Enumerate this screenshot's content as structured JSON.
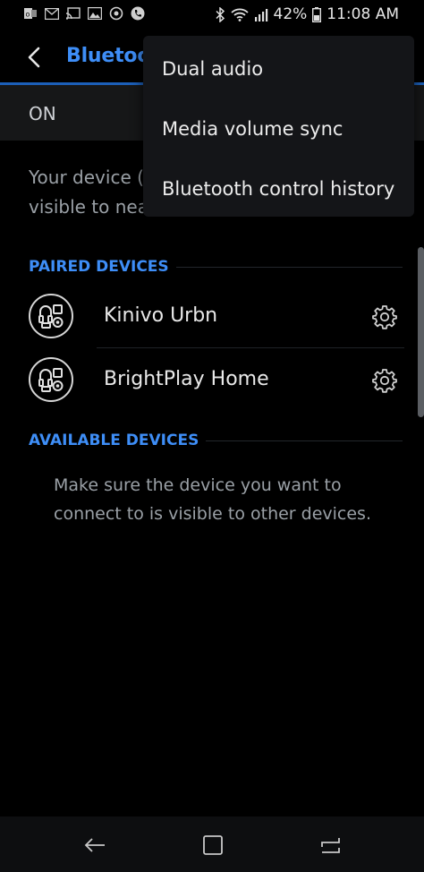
{
  "status_bar": {
    "battery": "42%",
    "time": "11:08 AM",
    "left_icons": [
      "outlook-notification-icon",
      "email-icon",
      "cast-icon",
      "image-icon",
      "sync-icon",
      "phone-call-icon"
    ],
    "right_icons": [
      "bluetooth-icon",
      "wifi-icon",
      "cellular-signal-icon",
      "battery-icon"
    ]
  },
  "app_bar": {
    "title": "Bluetooth",
    "back_icon": "back-arrow-icon"
  },
  "switch": {
    "label": "ON"
  },
  "description": {
    "line1": "Your device (",
    "line2": "visible to nea"
  },
  "paired": {
    "header": "PAIRED DEVICES",
    "devices": [
      {
        "name": "Kinivo Urbn",
        "icon": "audio-device-icon"
      },
      {
        "name": "BrightPlay Home",
        "icon": "audio-device-icon"
      }
    ]
  },
  "available": {
    "header": "AVAILABLE DEVICES",
    "hint": "Make sure the device you want to connect to is visible to other devices."
  },
  "menu": {
    "items": [
      {
        "label": "Dual audio"
      },
      {
        "label": "Media volume sync"
      },
      {
        "label": "Bluetooth control history"
      }
    ]
  },
  "colors": {
    "accent": "#3e8ef7",
    "background": "#000000",
    "menu_background": "#141518"
  }
}
